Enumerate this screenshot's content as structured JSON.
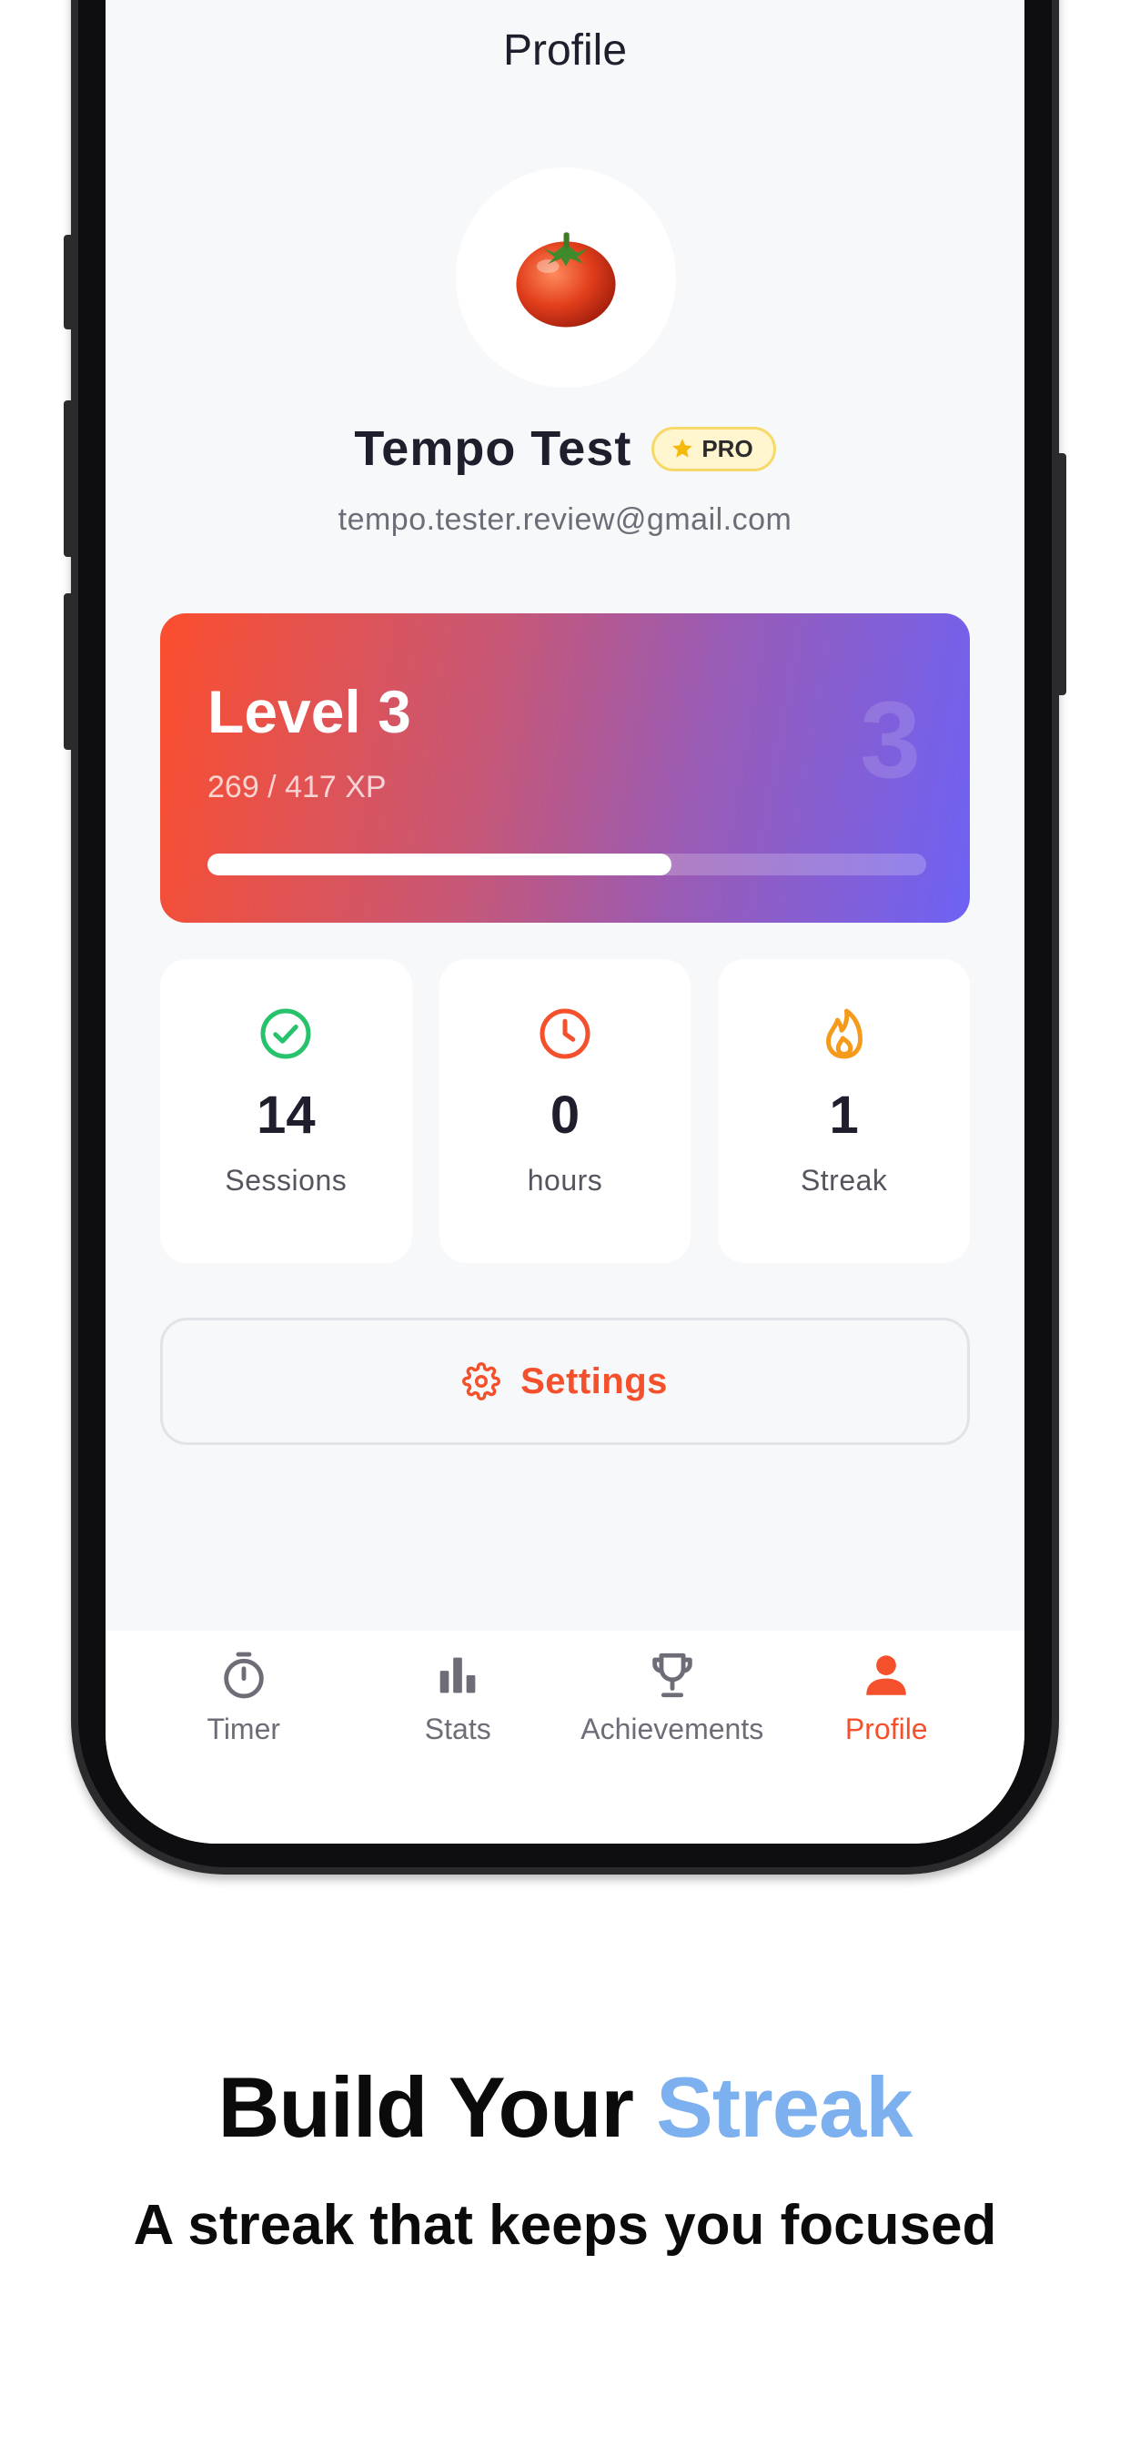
{
  "header": {
    "title": "Profile"
  },
  "profile": {
    "avatar_icon": "tomato-icon",
    "name": "Tempo Test",
    "badge": "PRO",
    "email": "tempo.tester.review@gmail.com"
  },
  "level": {
    "title": "Level 3",
    "number": "3",
    "xp_text": "269 / 417 XP",
    "progress": 0.645
  },
  "stats": [
    {
      "value": "14",
      "label": "Sessions",
      "icon": "check-circle-icon",
      "color": "#27c26c"
    },
    {
      "value": "0",
      "label": "hours",
      "icon": "clock-icon",
      "color": "#f4502c"
    },
    {
      "value": "1",
      "label": "Streak",
      "icon": "flame-icon",
      "color": "#f59a1b"
    }
  ],
  "settings": {
    "label": "Settings",
    "icon": "gear-icon"
  },
  "tabs": [
    {
      "label": "Timer",
      "icon": "stopwatch-icon",
      "active": false
    },
    {
      "label": "Stats",
      "icon": "bar-chart-icon",
      "active": false
    },
    {
      "label": "Achievements",
      "icon": "trophy-icon",
      "active": false
    },
    {
      "label": "Profile",
      "icon": "person-icon",
      "active": true
    }
  ],
  "marketing": {
    "headline_part1": "Build Your ",
    "headline_accent": "Streak",
    "subheadline": "A streak that keeps you focused"
  },
  "colors": {
    "accent": "#f4502c",
    "gradient_start": "#fb4e2e",
    "gradient_end": "#6e62f4",
    "headline_accent": "#7cb0ee"
  }
}
